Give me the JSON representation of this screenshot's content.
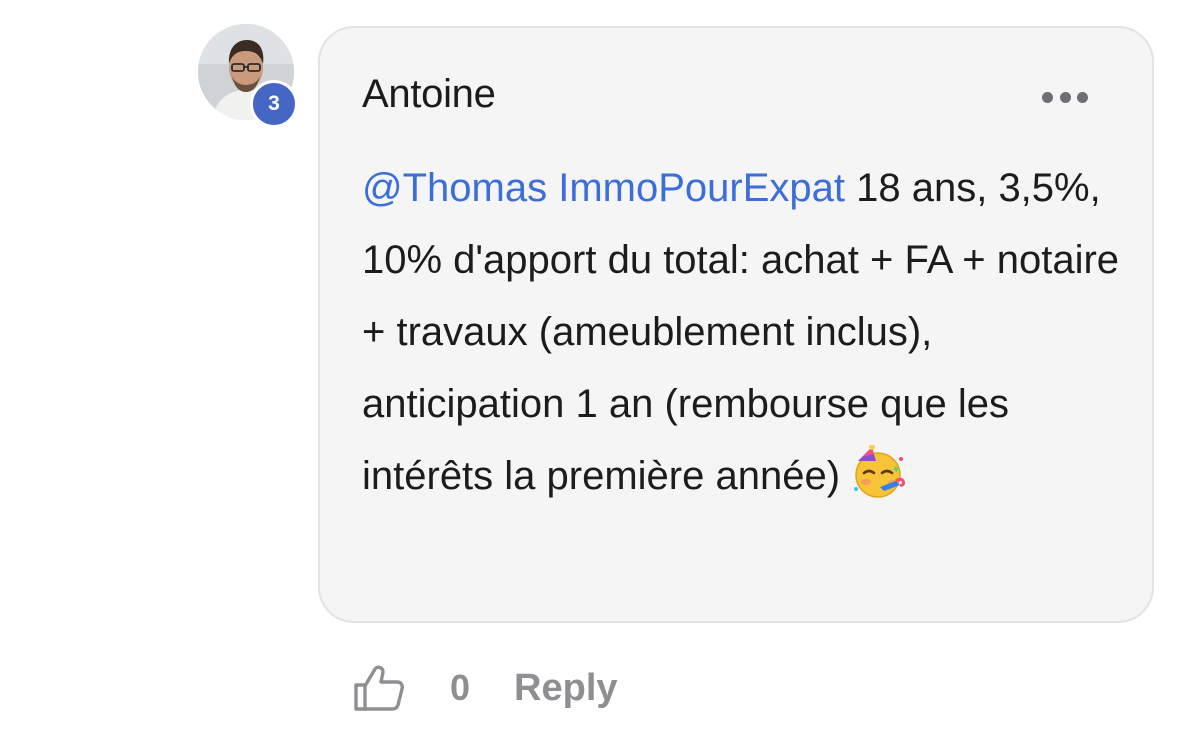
{
  "comment": {
    "author": "Antoine",
    "avatar_badge": "3",
    "mention": "@Thomas ImmoPourExpat",
    "body": " 18 ans, 3,5%, 10% d'apport du total: achat + FA + notaire + travaux (ameublement inclus), anticipation 1 an (rembourse que les intérêts la première année)",
    "emoji": "partying-face-emoji",
    "more_icon": "more-horizontal-icon"
  },
  "actions": {
    "like_icon": "thumbs-up-icon",
    "like_count": "0",
    "reply_label": "Reply"
  },
  "colors": {
    "mention": "#3b6ed8",
    "badge": "#4566c4",
    "bubble_bg": "#f5f5f6",
    "muted_text": "#8e8e93"
  }
}
